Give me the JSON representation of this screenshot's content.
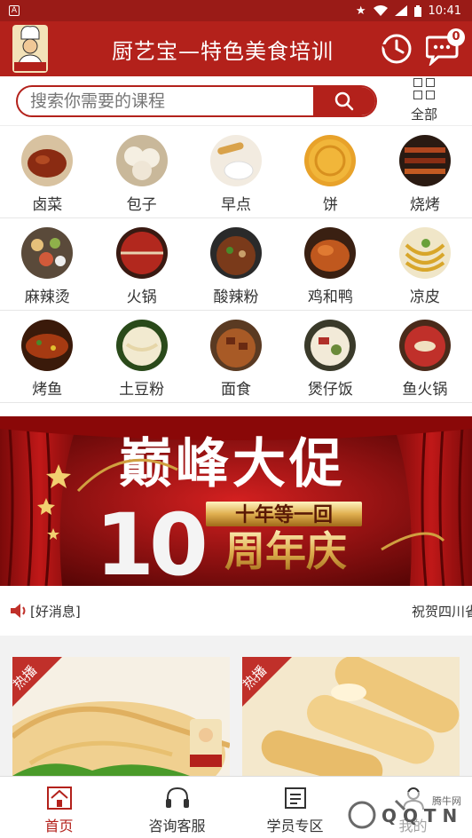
{
  "status_bar": {
    "time": "10:41"
  },
  "header": {
    "title": "厨艺宝—特色美食培训",
    "logo_text": "厨艺宝",
    "message_count": "0"
  },
  "search": {
    "placeholder": "搜索你需要的课程",
    "all_label": "全部"
  },
  "categories": [
    [
      {
        "label": "卤菜",
        "color": "#8a2b12"
      },
      {
        "label": "包子",
        "color": "#efe6d6"
      },
      {
        "label": "早点",
        "color": "#e8d2a6"
      },
      {
        "label": "饼",
        "color": "#f1b63a"
      },
      {
        "label": "烧烤",
        "color": "#6a2a1a"
      }
    ],
    [
      {
        "label": "麻辣烫",
        "color": "#7a5a3a"
      },
      {
        "label": "火锅",
        "color": "#b2281e"
      },
      {
        "label": "酸辣粉",
        "color": "#7a3a1a"
      },
      {
        "label": "鸡和鸭",
        "color": "#c0581e"
      },
      {
        "label": "凉皮",
        "color": "#d8a62a"
      }
    ],
    [
      {
        "label": "烤鱼",
        "color": "#a53a12"
      },
      {
        "label": "土豆粉",
        "color": "#e6d6a8"
      },
      {
        "label": "面食",
        "color": "#a85a26"
      },
      {
        "label": "煲仔饭",
        "color": "#6a8a3a"
      },
      {
        "label": "鱼火锅",
        "color": "#c0302a"
      }
    ]
  ],
  "banner": {
    "headline": "巅峰大促",
    "number": "10",
    "tagline": "十年等一回",
    "subtitle": "周年庆"
  },
  "news": {
    "tag": "[好消息]",
    "text": "祝贺四川省"
  },
  "courses": [
    {
      "badge": "热播"
    },
    {
      "badge": "热播"
    }
  ],
  "tabs": [
    {
      "label": "首页",
      "active": true
    },
    {
      "label": "咨询客服",
      "active": false
    },
    {
      "label": "学员专区",
      "active": false
    },
    {
      "label": "我的",
      "active": false
    }
  ],
  "watermark": {
    "text": "腾牛网"
  },
  "colors": {
    "brand": "#b3211b",
    "status_bar": "#9a1b17"
  }
}
